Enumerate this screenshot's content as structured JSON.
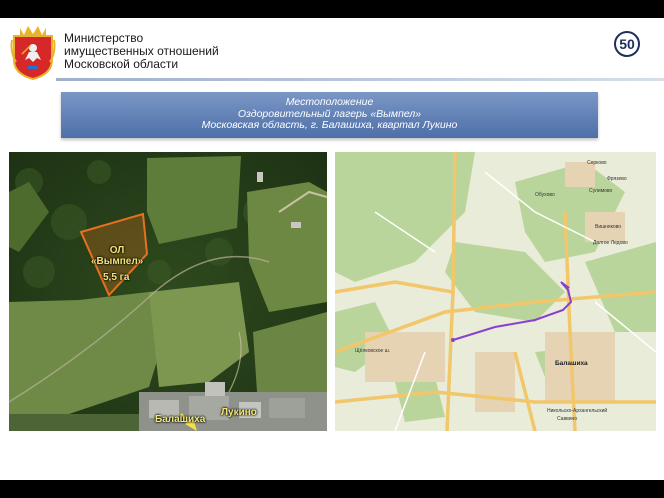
{
  "header": {
    "ministry_line1": "Министерство",
    "ministry_line2": "имущественных отношений",
    "ministry_line3": "Московской области",
    "page_number": "50"
  },
  "title": {
    "line1": "Местоположение",
    "line2": "Оздоровительный лагерь «Вымпел»",
    "line3": "Московская область, г. Балашиха, квартал Лукино"
  },
  "satellite_map": {
    "camp_label_line1": "ОЛ",
    "camp_label_line2": "«Вымпел»",
    "area_label": "5,5 га",
    "city_label": "Балашиха",
    "village_label": "Лукино"
  },
  "road_map": {
    "labels": [
      "Балашиха",
      "Фрязево",
      "Серково",
      "Сулимово",
      "Вишняково",
      "Долгое Ледово",
      "Никольско-Архангельский",
      "Саввино",
      "Щёлковское ш.",
      "Обухово"
    ]
  },
  "colors": {
    "title_gradient_top": "#7a97c6",
    "title_gradient_bottom": "#4e6fa8",
    "plot_outline": "#e8701e",
    "label_yellow": "#f0e67a",
    "route_purple": "#8a3fd0"
  }
}
